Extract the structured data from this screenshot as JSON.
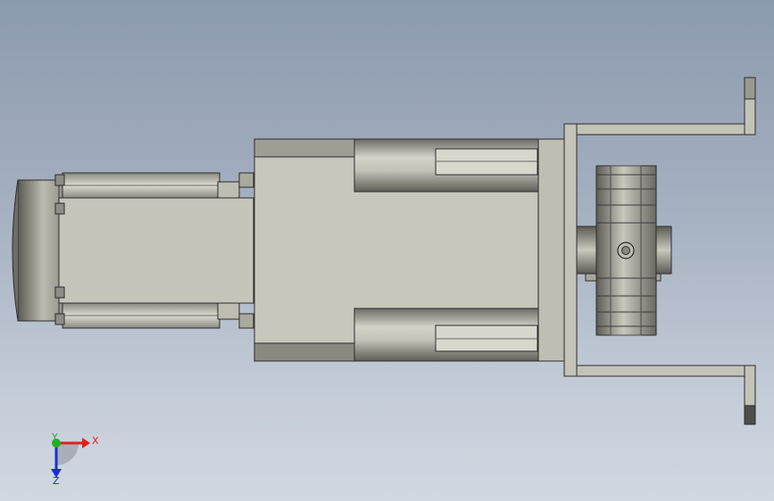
{
  "viewport": {
    "background_top": "#8c9aae",
    "background_bottom": "#d2d8e2"
  },
  "model": {
    "view": "top",
    "edge_color": "#2a2a2a",
    "face_light": "#c9c8bd",
    "face_mid": "#b3b2a6",
    "face_dark": "#7d7c74"
  },
  "triad": {
    "x_label": "X",
    "y_label": "Y",
    "z_label": "Z",
    "x_color": "#e0201c",
    "y_color": "#22b022",
    "z_color": "#1a2fd0"
  }
}
